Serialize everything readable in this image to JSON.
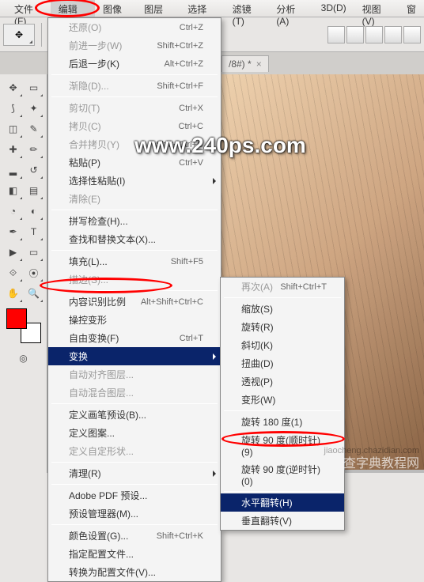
{
  "menubar": {
    "file": "文件(F)",
    "edit": "编辑(E)",
    "image": "图像(I)",
    "layer": "图层(L)",
    "select": "选择(S)",
    "filter": "滤镜(T)",
    "analysis": "分析(A)",
    "3d": "3D(D)",
    "view": "视图(V)",
    "windo": "窗"
  },
  "doc": {
    "tab": "/8#) *",
    "close": "×"
  },
  "edit_menu": {
    "undo": {
      "label": "还原(O)",
      "sc": "Ctrl+Z"
    },
    "step_forward": {
      "label": "前进一步(W)",
      "sc": "Shift+Ctrl+Z"
    },
    "step_back": {
      "label": "后退一步(K)",
      "sc": "Alt+Ctrl+Z"
    },
    "fade": {
      "label": "渐隐(D)...",
      "sc": "Shift+Ctrl+F"
    },
    "cut": {
      "label": "剪切(T)",
      "sc": "Ctrl+X"
    },
    "copy": {
      "label": "拷贝(C)",
      "sc": "Ctrl+C"
    },
    "copy_merged": {
      "label": "合并拷贝(Y)",
      "sc": "Shift+Ctrl+C"
    },
    "paste": {
      "label": "粘贴(P)",
      "sc": "Ctrl+V"
    },
    "paste_special": {
      "label": "选择性粘贴(I)",
      "sc": ""
    },
    "clear": {
      "label": "清除(E)",
      "sc": ""
    },
    "spell": {
      "label": "拼写检查(H)...",
      "sc": ""
    },
    "find": {
      "label": "查找和替换文本(X)...",
      "sc": ""
    },
    "fill": {
      "label": "填充(L)...",
      "sc": "Shift+F5"
    },
    "stroke": {
      "label": "描边(S)...",
      "sc": ""
    },
    "content_aware": {
      "label": "内容识别比例",
      "sc": "Alt+Shift+Ctrl+C"
    },
    "puppet": {
      "label": "操控变形",
      "sc": ""
    },
    "free_transform": {
      "label": "自由变换(F)",
      "sc": "Ctrl+T"
    },
    "transform": {
      "label": "变换",
      "sc": ""
    },
    "auto_align": {
      "label": "自动对齐图层...",
      "sc": ""
    },
    "auto_blend": {
      "label": "自动混合图层...",
      "sc": ""
    },
    "brush_preset": {
      "label": "定义画笔预设(B)...",
      "sc": ""
    },
    "pattern": {
      "label": "定义图案...",
      "sc": ""
    },
    "shape_preset": {
      "label": "定义自定形状...",
      "sc": ""
    },
    "purge": {
      "label": "清理(R)",
      "sc": ""
    },
    "pdf_presets": {
      "label": "Adobe PDF 预设...",
      "sc": ""
    },
    "preset_manager": {
      "label": "预设管理器(M)...",
      "sc": ""
    },
    "color_settings": {
      "label": "颜色设置(G)...",
      "sc": "Shift+Ctrl+K"
    },
    "assign_profile": {
      "label": "指定配置文件...",
      "sc": ""
    },
    "convert_profile": {
      "label": "转换为配置文件(V)...",
      "sc": ""
    }
  },
  "transform_menu": {
    "again": {
      "label": "再次(A)",
      "sc": "Shift+Ctrl+T"
    },
    "scale": {
      "label": "缩放(S)",
      "sc": ""
    },
    "rotate": {
      "label": "旋转(R)",
      "sc": ""
    },
    "skew": {
      "label": "斜切(K)",
      "sc": ""
    },
    "distort": {
      "label": "扭曲(D)",
      "sc": ""
    },
    "perspective": {
      "label": "透视(P)",
      "sc": ""
    },
    "warp": {
      "label": "变形(W)",
      "sc": ""
    },
    "rotate180": {
      "label": "旋转 180 度(1)",
      "sc": ""
    },
    "rotate90cw": {
      "label": "旋转 90 度(顺时针)(9)",
      "sc": ""
    },
    "rotate90ccw": {
      "label": "旋转 90 度(逆时针)(0)",
      "sc": ""
    },
    "flip_h": {
      "label": "水平翻转(H)",
      "sc": ""
    },
    "flip_v": {
      "label": "垂直翻转(V)",
      "sc": ""
    }
  },
  "watermark": {
    "main": "www.240ps.com",
    "footer_site": "查字典教程网",
    "footer_url": "jiaocheng.chazidian.com"
  }
}
